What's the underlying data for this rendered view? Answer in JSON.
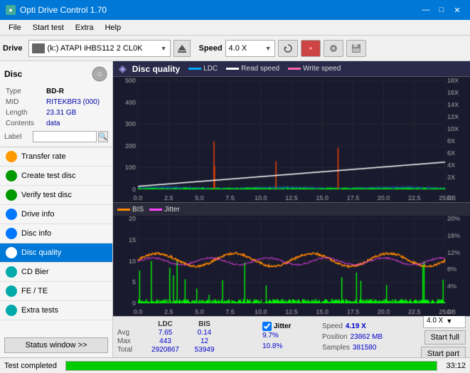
{
  "titlebar": {
    "title": "Opti Drive Control 1.70",
    "icon": "●",
    "min": "—",
    "max": "□",
    "close": "✕"
  },
  "menubar": {
    "items": [
      "File",
      "Start test",
      "Extra",
      "Help"
    ]
  },
  "toolbar": {
    "drive_label": "Drive",
    "drive_value": "(k:)  ATAPI iHBS112  2 CL0K",
    "speed_label": "Speed",
    "speed_value": "4.0 X"
  },
  "disc": {
    "label": "Disc",
    "type_label": "Type",
    "type_value": "BD-R",
    "mid_label": "MID",
    "mid_value": "RITEKBR3 (000)",
    "length_label": "Length",
    "length_value": "23.31 GB",
    "contents_label": "Contents",
    "contents_value": "data",
    "label_label": "Label",
    "label_value": ""
  },
  "sidebar": {
    "items": [
      {
        "id": "transfer-rate",
        "label": "Transfer rate",
        "icon_color": "orange"
      },
      {
        "id": "create-test-disc",
        "label": "Create test disc",
        "icon_color": "green"
      },
      {
        "id": "verify-test-disc",
        "label": "Verify test disc",
        "icon_color": "green"
      },
      {
        "id": "drive-info",
        "label": "Drive info",
        "icon_color": "blue"
      },
      {
        "id": "disc-info",
        "label": "Disc info",
        "icon_color": "blue"
      },
      {
        "id": "disc-quality",
        "label": "Disc quality",
        "icon_color": "blue",
        "active": true
      },
      {
        "id": "cd-bier",
        "label": "CD Bier",
        "icon_color": "teal"
      },
      {
        "id": "fe-te",
        "label": "FE / TE",
        "icon_color": "teal"
      },
      {
        "id": "extra-tests",
        "label": "Extra tests",
        "icon_color": "teal"
      }
    ],
    "status_btn": "Status window >>"
  },
  "chart": {
    "title": "Disc quality",
    "legend": [
      {
        "label": "LDC",
        "color": "#00aaff"
      },
      {
        "label": "Read speed",
        "color": "#ffffff"
      },
      {
        "label": "Write speed",
        "color": "#ff66aa"
      }
    ],
    "top": {
      "y_max": 500,
      "y_right_max": 18,
      "y_right_unit": "X",
      "x_max": 25,
      "x_unit": "GB"
    },
    "bottom": {
      "y_max": 20,
      "y_right_max": "20%",
      "legend": [
        {
          "label": "BIS",
          "color": "#ff8800"
        },
        {
          "label": "Jitter",
          "color": "#ff44ff"
        }
      ]
    }
  },
  "stats": {
    "columns": [
      "",
      "LDC",
      "BIS"
    ],
    "rows": [
      {
        "label": "Avg",
        "ldc": "7.65",
        "bis": "0.14"
      },
      {
        "label": "Max",
        "ldc": "443",
        "bis": "12"
      },
      {
        "label": "Total",
        "ldc": "2920867",
        "bis": "53949"
      }
    ],
    "jitter": {
      "label": "Jitter",
      "avg": "9.7%",
      "max": "10.8%",
      "checked": true
    },
    "speed_label": "Speed",
    "speed_value": "4.19 X",
    "speed_select": "4.0 X",
    "position_label": "Position",
    "position_value": "23862 MB",
    "samples_label": "Samples",
    "samples_value": "381580",
    "btn_start_full": "Start full",
    "btn_start_part": "Start part"
  },
  "statusbar": {
    "text": "Test completed",
    "progress": 100,
    "time": "33:12"
  }
}
